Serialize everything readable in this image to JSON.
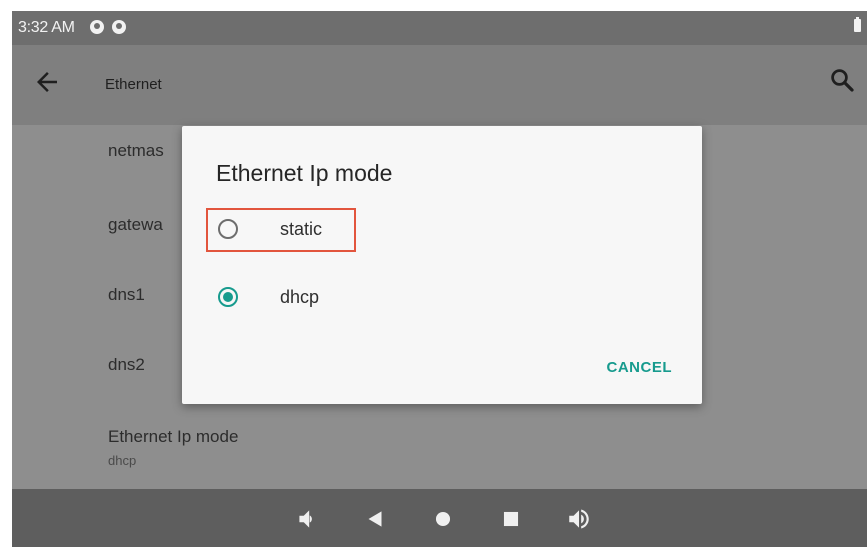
{
  "status_bar": {
    "time": "3:32 AM",
    "icons": [
      "notification-icon",
      "notification-icon",
      "battery-icon"
    ]
  },
  "app_bar": {
    "title": "Ethernet",
    "icons": [
      "back-arrow-icon",
      "search-icon"
    ]
  },
  "settings_list": {
    "items": [
      {
        "label": "netmas"
      },
      {
        "label": "gatewa"
      },
      {
        "label": "dns1"
      },
      {
        "label": "dns2"
      },
      {
        "label": "Ethernet Ip mode",
        "summary": "dhcp"
      }
    ]
  },
  "dialog": {
    "title": "Ethernet Ip mode",
    "options": [
      {
        "label": "static",
        "selected": false
      },
      {
        "label": "dhcp",
        "selected": true
      }
    ],
    "cancel_label": "CANCEL"
  },
  "nav_bar": {
    "icons": [
      "volume-down-icon",
      "back-icon",
      "home-icon",
      "recents-icon",
      "volume-up-icon"
    ]
  },
  "colors": {
    "accent": "#179b8e",
    "highlight": "#e2553d",
    "dialog_background": "#f7f7f7",
    "scrim": "#8e8e8e"
  }
}
